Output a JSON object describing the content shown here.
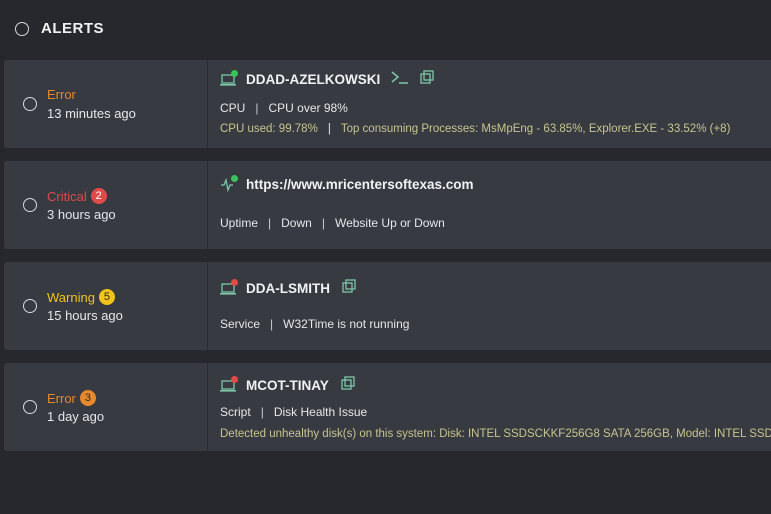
{
  "header": {
    "title": "ALERTS"
  },
  "colors": {
    "error": "#e8892b",
    "critical": "#e24a4a",
    "warning": "#f0c419",
    "online": "#3ac35a",
    "offline": "#e24a4a",
    "detail": "#c7c58f",
    "icon": "#7ec8a8"
  },
  "alerts": [
    {
      "severity": "Error",
      "badge": "",
      "time": "13 minutes ago",
      "host": "DDAD-AZELKOWSKI",
      "status": "online",
      "category": "CPU",
      "description": "CPU over 98%",
      "detail_type": "",
      "detail_a": "CPU used: 99.78%",
      "detail_b": "Top consuming Processes: MsMpEng - 63.85%, Explorer.EXE - 33.52% (+8)"
    },
    {
      "severity": "Critical",
      "badge": "2",
      "time": "3 hours ago",
      "host": "https://www.mricentersoftexas.com",
      "status": "online",
      "category": "Uptime",
      "description": "Down",
      "detail_type": "Website Up or Down"
    },
    {
      "severity": "Warning",
      "badge": "5",
      "time": "15 hours ago",
      "host": "DDA-LSMITH",
      "status": "offline",
      "category": "Service",
      "description": "W32Time is not running"
    },
    {
      "severity": "Error",
      "badge": "3",
      "time": "1 day ago",
      "host": "MCOT-TINAY",
      "status": "offline",
      "category": "Script",
      "description": "Disk Health Issue",
      "detail_a": "Detected unhealthy disk(s) on this system: Disk: INTEL SSDSCKKF256G8 SATA 256GB, Model: INTEL SSDSC"
    }
  ]
}
